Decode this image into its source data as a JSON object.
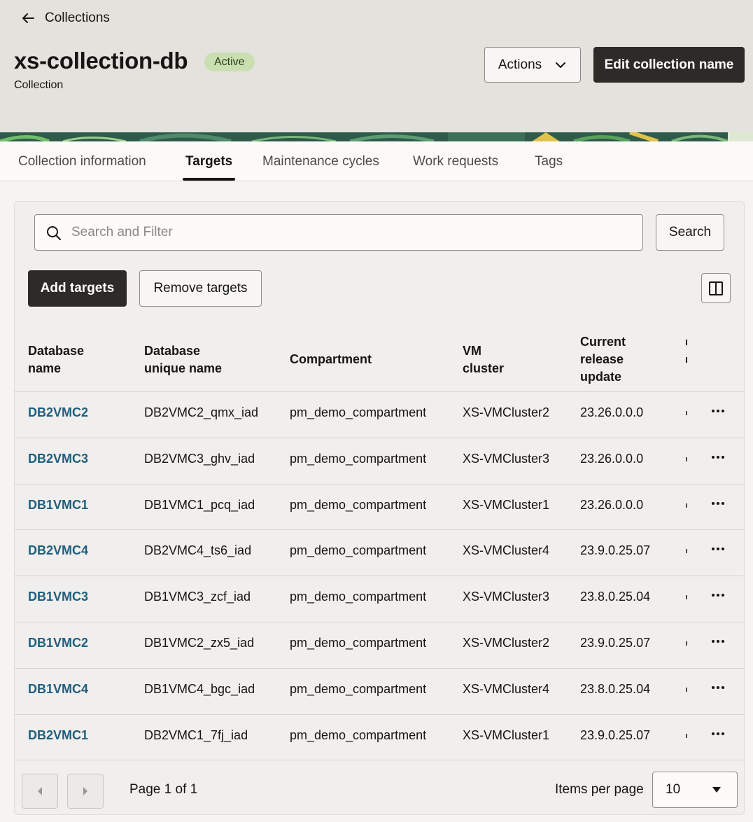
{
  "header": {
    "back_label": "Collections",
    "title": "xs-collection-db",
    "status": "Active",
    "subtitle": "Collection",
    "actions_label": "Actions",
    "edit_label": "Edit collection name"
  },
  "tabs": [
    {
      "label": "Collection information",
      "active": false
    },
    {
      "label": "Targets",
      "active": true
    },
    {
      "label": "Maintenance cycles",
      "active": false
    },
    {
      "label": "Work requests",
      "active": false
    },
    {
      "label": "Tags",
      "active": false
    }
  ],
  "toolbar": {
    "search_placeholder": "Search and Filter",
    "search_label": "Search",
    "add_label": "Add targets",
    "remove_label": "Remove targets"
  },
  "table": {
    "columns": [
      {
        "line1": "Database",
        "line2": "name",
        "line3": ""
      },
      {
        "line1": "Database",
        "line2": "unique name",
        "line3": ""
      },
      {
        "line1": "Compartment",
        "line2": "",
        "line3": ""
      },
      {
        "line1": "VM",
        "line2": "cluster",
        "line3": ""
      },
      {
        "line1": "Current",
        "line2": "release",
        "line3": "update"
      }
    ],
    "rows": [
      {
        "name": "DB2VMC2",
        "unique": "DB2VMC2_qmx_iad",
        "compartment": "pm_demo_compartment",
        "cluster": "XS-VMCluster2",
        "release": "23.26.0.0.0"
      },
      {
        "name": "DB2VMC3",
        "unique": "DB2VMC3_ghv_iad",
        "compartment": "pm_demo_compartment",
        "cluster": "XS-VMCluster3",
        "release": "23.26.0.0.0"
      },
      {
        "name": "DB1VMC1",
        "unique": "DB1VMC1_pcq_iad",
        "compartment": "pm_demo_compartment",
        "cluster": "XS-VMCluster1",
        "release": "23.26.0.0.0"
      },
      {
        "name": "DB2VMC4",
        "unique": "DB2VMC4_ts6_iad",
        "compartment": "pm_demo_compartment",
        "cluster": "XS-VMCluster4",
        "release": "23.9.0.25.07"
      },
      {
        "name": "DB1VMC3",
        "unique": "DB1VMC3_zcf_iad",
        "compartment": "pm_demo_compartment",
        "cluster": "XS-VMCluster3",
        "release": "23.8.0.25.04"
      },
      {
        "name": "DB1VMC2",
        "unique": "DB1VMC2_zx5_iad",
        "compartment": "pm_demo_compartment",
        "cluster": "XS-VMCluster2",
        "release": "23.9.0.25.07"
      },
      {
        "name": "DB1VMC4",
        "unique": "DB1VMC4_bgc_iad",
        "compartment": "pm_demo_compartment",
        "cluster": "XS-VMCluster4",
        "release": "23.8.0.25.04"
      },
      {
        "name": "DB2VMC1",
        "unique": "DB2VMC1_7fj_iad",
        "compartment": "pm_demo_compartment",
        "cluster": "XS-VMCluster1",
        "release": "23.9.0.25.07"
      }
    ]
  },
  "pagination": {
    "page_label": "Page 1 of 1",
    "items_per_page_label": "Items per page",
    "items_per_page_value": "10"
  },
  "colors": {
    "primary_button": "#2d2a27",
    "link": "#1e5f7f",
    "status_badge": "#c9dfb0",
    "header_bg": "#e4e2dd"
  }
}
